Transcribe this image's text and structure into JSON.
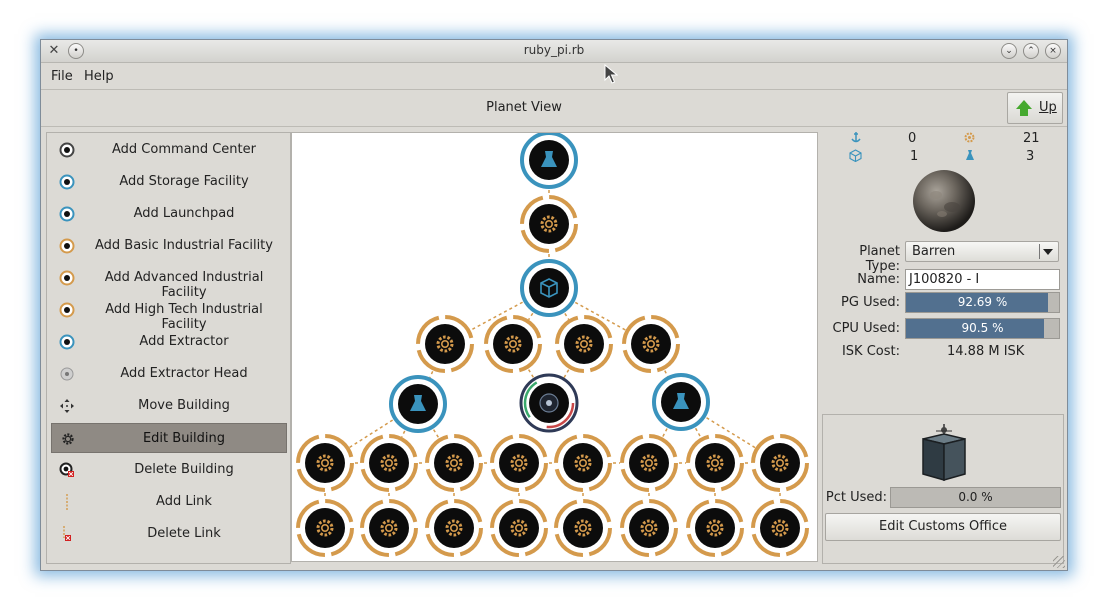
{
  "window": {
    "title": "ruby_pi.rb"
  },
  "menu": {
    "file": "File",
    "help": "Help"
  },
  "toolbar": {
    "view_title": "Planet View",
    "up_label": "Up"
  },
  "left_panel": {
    "items": [
      {
        "label": "Add Command Center",
        "icon": "command-center-icon"
      },
      {
        "label": "Add Storage Facility",
        "icon": "storage-icon"
      },
      {
        "label": "Add Launchpad",
        "icon": "launchpad-icon"
      },
      {
        "label": "Add Basic Industrial Facility",
        "icon": "basic-industry-icon"
      },
      {
        "label": "Add Advanced Industrial Facility",
        "icon": "advanced-industry-icon"
      },
      {
        "label": "Add High Tech Industrial Facility",
        "icon": "hightech-industry-icon"
      },
      {
        "label": "Add Extractor",
        "icon": "extractor-icon"
      },
      {
        "label": "Add Extractor Head",
        "icon": "extractor-head-icon"
      },
      {
        "label": "Move Building",
        "icon": "move-icon"
      },
      {
        "label": "Edit Building",
        "icon": "gear-icon",
        "selected": true
      },
      {
        "label": "Delete Building",
        "icon": "delete-building-icon"
      },
      {
        "label": "Add Link",
        "icon": "link-icon"
      },
      {
        "label": "Delete Link",
        "icon": "delete-link-icon"
      }
    ]
  },
  "stats": {
    "launchpads": "0",
    "factories": "21",
    "storage": "1",
    "extractors": "3"
  },
  "planet": {
    "type_label": "Planet Type:",
    "type_value": "Barren",
    "name_label": "Name:",
    "name_value": "J100820 - I",
    "pg_label": "PG Used:",
    "pg_value": "92.69 %",
    "pg_fraction": 0.9269,
    "cpu_label": "CPU Used:",
    "cpu_value": "90.5 %",
    "cpu_fraction": 0.905,
    "isk_label": "ISK Cost:",
    "isk_value": "14.88 M ISK"
  },
  "customs": {
    "pct_label": "Pct Used:",
    "pct_value": "0.0 %",
    "pct_fraction": 0.0,
    "edit_label": "Edit Customs Office"
  },
  "colors": {
    "factory": "#d49a4c",
    "storage": "#3a93bd",
    "command": "#2f3a57",
    "node_bg": "#0c0c0c",
    "bar_fill": "#52708f"
  }
}
